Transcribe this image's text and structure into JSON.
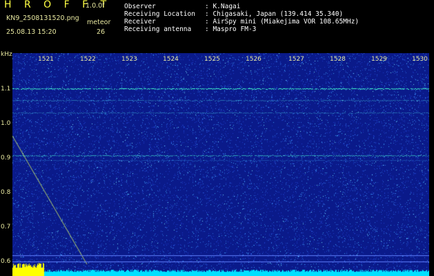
{
  "app": {
    "title": "H R O F F T",
    "version": "1.0.0f",
    "filename": "KN9_2508131520.png",
    "datetime": "25.08.13 15:20",
    "meteor_label": "meteor",
    "meteor_count": "26"
  },
  "info": {
    "observer_label": "Observer",
    "observer_value": ": K.Nagai",
    "location_label": "Receiving Location",
    "location_value": ": Chigasaki, Japan (139.414 35.340)",
    "receiver_label": "Receiver",
    "receiver_value": ": AirSpy mini (Miakejima VOR 108.65MHz)",
    "antenna_label": "Receiving antenna",
    "antenna_value": ": Maspro FM-3"
  },
  "axis": {
    "y_unit": "kHz",
    "y_ticks": [
      "1.1",
      "1.0",
      "0.9",
      "0.8",
      "0.7",
      "0.6"
    ],
    "time_ticks": [
      "1521",
      "1522",
      "1523",
      "1524",
      "1525",
      "1526",
      "1527",
      "1528",
      "1529",
      "1530"
    ]
  },
  "colors": {
    "background": "#000000",
    "waterfall_bg": "#0a1a8a",
    "signal": "#40ffd0",
    "meteor_trail": "#e0ff60",
    "noise_bar": "#00e0ff",
    "noise_bar_start": "#ffff00",
    "label": "#e8e8a0"
  }
}
